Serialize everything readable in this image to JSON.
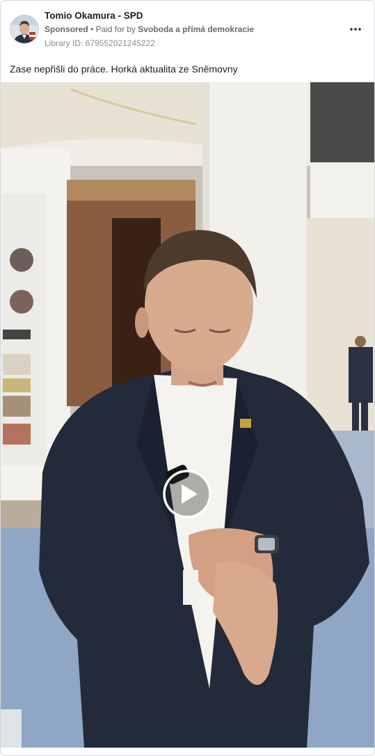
{
  "ad": {
    "page_name": "Tomio Okamura - SPD",
    "sponsored_label": "Sponsored",
    "separator": "•",
    "paid_for_prefix": "Paid for by",
    "paid_for_by": "Svoboda a přímá demokracie",
    "library_id": "Library ID: 679552021245222",
    "caption": "Zase nepřišli do práce. Horká aktualita ze Sněmovny"
  },
  "icons": {
    "more": "more-options-icon",
    "play": "play-icon"
  },
  "colors": {
    "text_primary": "#1c1e21",
    "text_secondary": "#65676b",
    "border": "#d5d8dc",
    "suit": "#232a3a",
    "carpet": "#8fa6c4"
  }
}
